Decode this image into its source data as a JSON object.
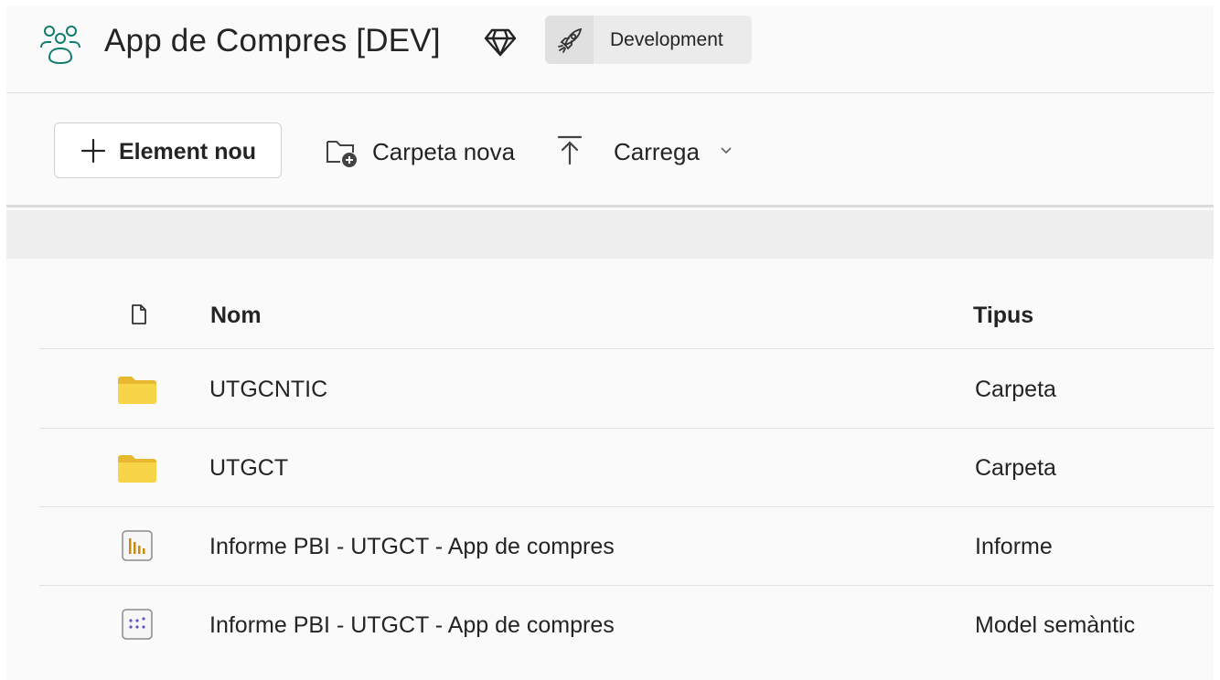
{
  "workspace": {
    "title": "App de Compres [DEV]",
    "icon": "workspace-people-icon",
    "premium_icon": "diamond-icon",
    "stage_badge": {
      "icon": "rocket-icon",
      "label": "Development"
    }
  },
  "toolbar": {
    "new_item_label": "Element nou",
    "new_folder_label": "Carpeta nova",
    "upload_label": "Carrega"
  },
  "list": {
    "columns": {
      "name": "Nom",
      "type": "Tipus"
    },
    "items": [
      {
        "name": "UTGCNTIC",
        "type": "Carpeta",
        "icon": "folder-icon"
      },
      {
        "name": "UTGCT",
        "type": "Carpeta",
        "icon": "folder-icon"
      },
      {
        "name": "Informe PBI - UTGCT - App de compres",
        "type": "Informe",
        "icon": "report-icon"
      },
      {
        "name": "Informe PBI - UTGCT - App de compres",
        "type": "Model semàntic",
        "icon": "semantic-model-icon"
      }
    ]
  },
  "colors": {
    "accent_teal": "#0f7b6c",
    "folder_yellow": "#f8d449",
    "report_gold": "#c98a12",
    "model_purple": "#6b4fbb"
  }
}
